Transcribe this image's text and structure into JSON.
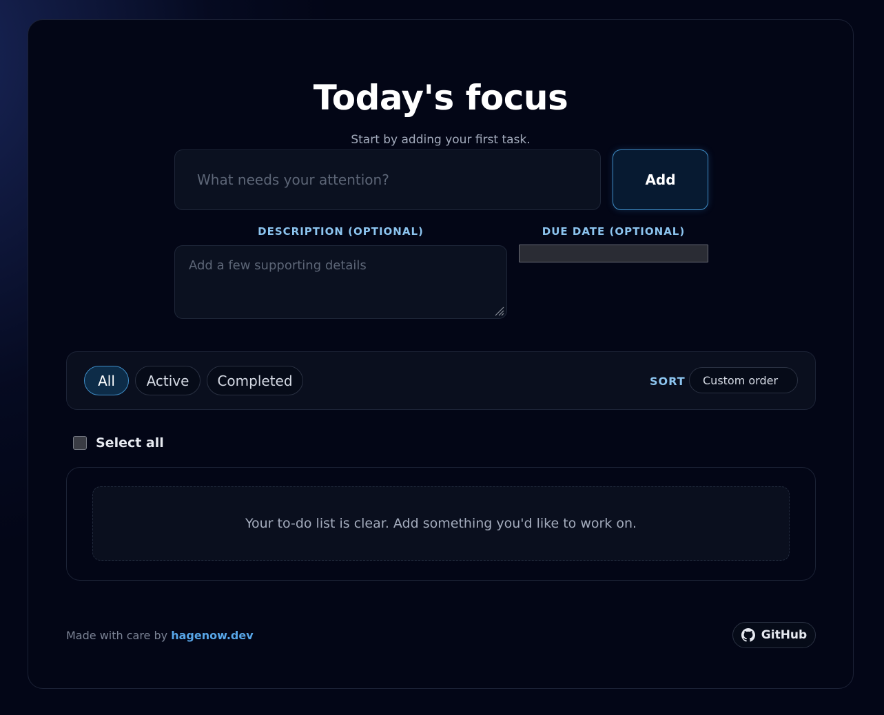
{
  "header": {
    "title": "Today's focus",
    "subtitle": "Start by adding your first task."
  },
  "new_task": {
    "placeholder": "What needs your attention?",
    "value": "",
    "add_label": "Add"
  },
  "description": {
    "label": "DESCRIPTION (OPTIONAL)",
    "placeholder": "Add a few supporting details",
    "value": ""
  },
  "due_date": {
    "label": "DUE DATE (OPTIONAL)",
    "value": ""
  },
  "filters": {
    "items": [
      {
        "label": "All",
        "active": true
      },
      {
        "label": "Active",
        "active": false
      },
      {
        "label": "Completed",
        "active": false
      }
    ],
    "sort_label": "SORT",
    "sort_value": "Custom order"
  },
  "select_all": {
    "label": "Select all",
    "checked": false
  },
  "list": {
    "empty_message": "Your to-do list is clear. Add something you'd like to work on."
  },
  "footer": {
    "credit_prefix": "Made with care by",
    "credit_link": "hagenow.dev",
    "github_label": "GitHub",
    "github_icon": "github-icon"
  },
  "colors": {
    "accent": "#3f8ec8",
    "label_blue": "#8cc4ef",
    "link_blue": "#58a6e8",
    "background": "#030616"
  }
}
